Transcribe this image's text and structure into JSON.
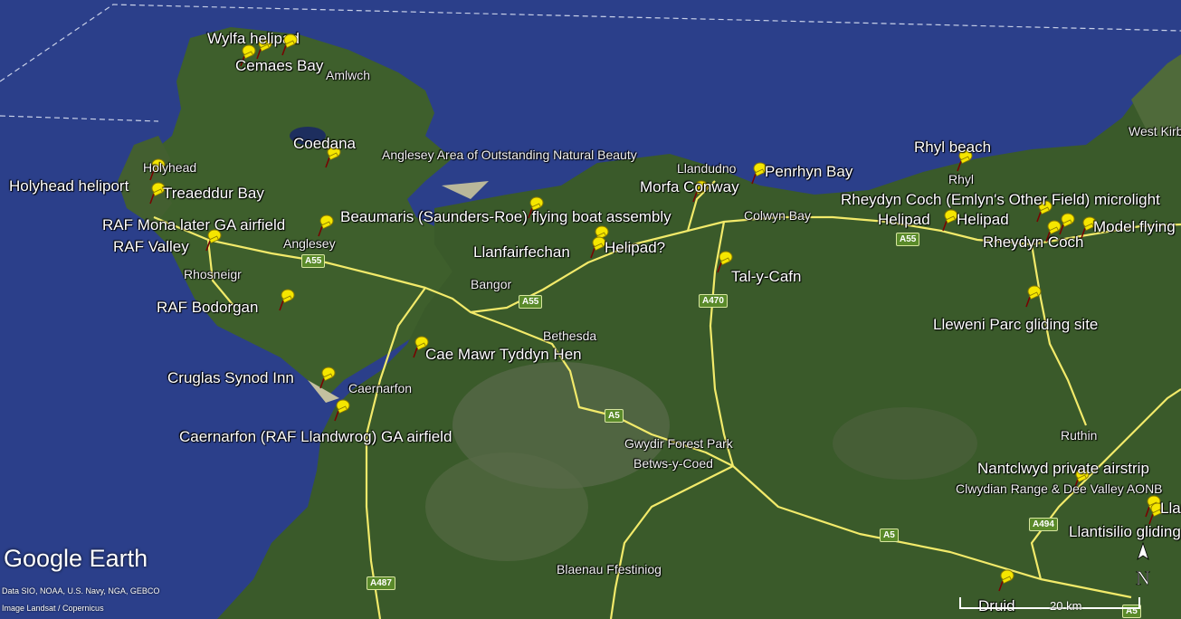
{
  "app": {
    "name": "Google Earth",
    "logo_text": "Google Earth"
  },
  "attribution": [
    "Data SIO, NOAA, U.S. Navy, NGA, GEBCO",
    "Image Landsat / Copernicus"
  ],
  "colors": {
    "sea": "#2b3f8a",
    "land": "#3c5f2e",
    "road": "#f2ea6a",
    "pin": "#f5e600",
    "label": "#ffffff"
  },
  "scale_bar": {
    "label": "20 km"
  },
  "compass": {
    "label": "N"
  },
  "pins": [
    {
      "label": "Wylfa helipad"
    },
    {
      "label": "Cemaes Bay"
    },
    {
      "label": "Coedana"
    },
    {
      "label": "Holyhead heliport"
    },
    {
      "label": "Treaeddur Bay"
    },
    {
      "label": "RAF Mona later GA airfield"
    },
    {
      "label": "RAF Valley"
    },
    {
      "label": "RAF Bodorgan"
    },
    {
      "label": "Cruglas Synod Inn"
    },
    {
      "label": "Caernarfon (RAF Llandwrog) GA airfield"
    },
    {
      "label": "Beaumaris (Saunders-Roe) flying boat assembly"
    },
    {
      "label": "Llanfairfechan"
    },
    {
      "label": "Helipad?"
    },
    {
      "label": "Cae Mawr Tyddyn Hen"
    },
    {
      "label": "Morfa Conway"
    },
    {
      "label": "Penrhyn Bay"
    },
    {
      "label": "Tal-y-Cafn"
    },
    {
      "label": "Rhyl  beach"
    },
    {
      "label": "Rheydyn Coch (Emlyn's Other Field) microlight"
    },
    {
      "label": "Helipad"
    },
    {
      "label": "Helipad"
    },
    {
      "label": "Rheydyn Coch"
    },
    {
      "label": "Model flying"
    },
    {
      "label": "Lleweni Parc gliding site"
    },
    {
      "label": "Nantclwyd private airstrip"
    },
    {
      "label": "Llantisilio gliding"
    },
    {
      "label": "Llantisilio"
    },
    {
      "label": "Druid"
    }
  ],
  "places": [
    {
      "label": "Amlwch"
    },
    {
      "label": "Holyhead"
    },
    {
      "label": "Anglesey"
    },
    {
      "label": "Rhosneigr"
    },
    {
      "label": "Anglesey Area of Outstanding Natural Beauty"
    },
    {
      "label": "Bangor"
    },
    {
      "label": "Bethesda"
    },
    {
      "label": "Caernarfon"
    },
    {
      "label": "Llandudno"
    },
    {
      "label": "Colwyn Bay"
    },
    {
      "label": "Rhyl"
    },
    {
      "label": "West Kirby"
    },
    {
      "label": "Gwydir Forest Park"
    },
    {
      "label": "Betws-y-Coed"
    },
    {
      "label": "Ruthin"
    },
    {
      "label": "Clwydian Range & Dee Valley AONB"
    },
    {
      "label": "Blaenau Ffestiniog"
    }
  ],
  "roads": [
    {
      "label": "A55"
    },
    {
      "label": "A55"
    },
    {
      "label": "A55"
    },
    {
      "label": "A470"
    },
    {
      "label": "A5"
    },
    {
      "label": "A5"
    },
    {
      "label": "A487"
    },
    {
      "label": "A494"
    },
    {
      "label": "A5"
    }
  ]
}
